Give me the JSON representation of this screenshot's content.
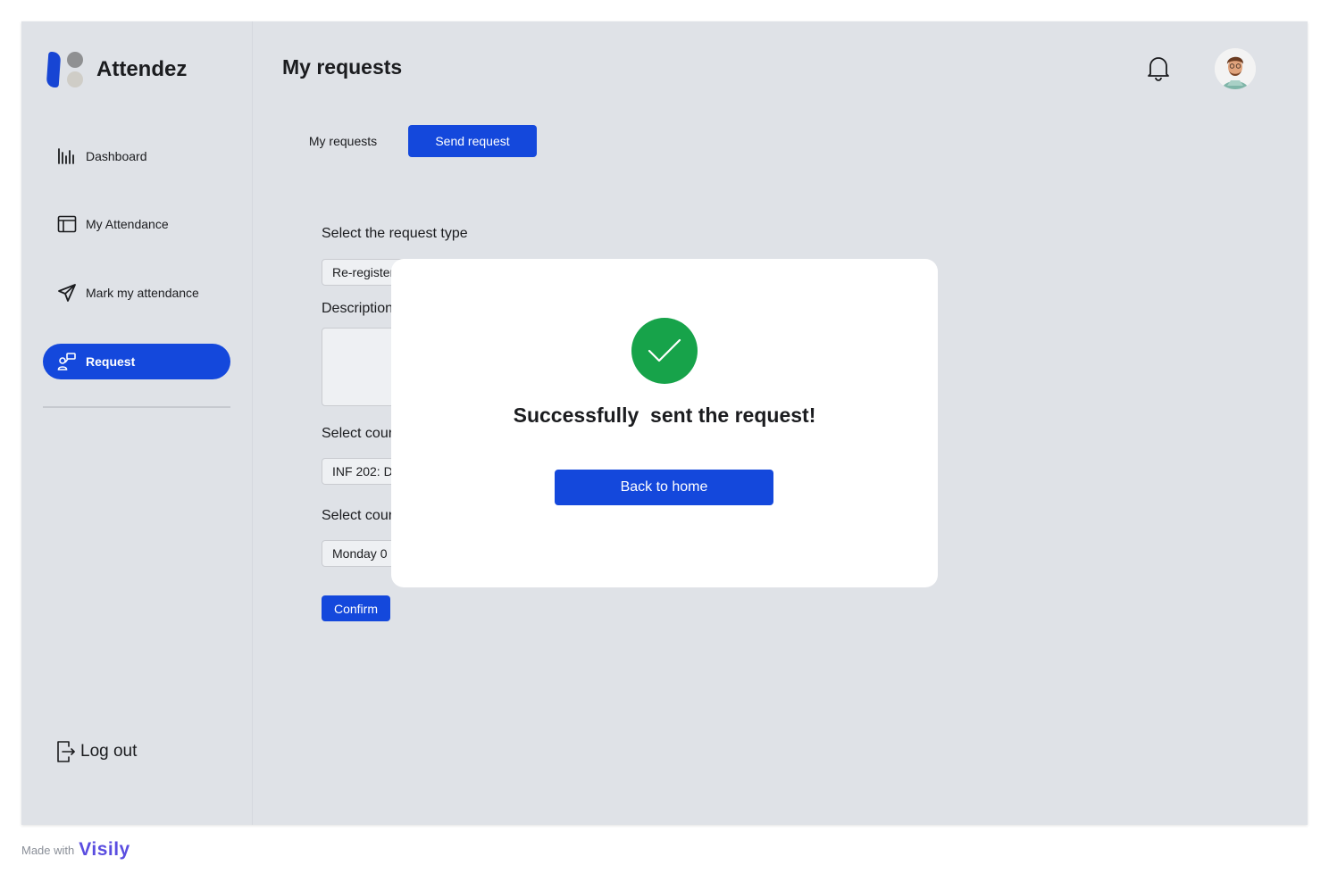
{
  "app": {
    "name": "Attendez"
  },
  "sidebar": {
    "items": [
      {
        "label": "Dashboard",
        "icon": "bar-chart-icon"
      },
      {
        "label": "My Attendance",
        "icon": "calendar-layout-icon"
      },
      {
        "label": "Mark my attendance",
        "icon": "send-icon"
      },
      {
        "label": "Request",
        "icon": "request-icon",
        "active": true
      }
    ],
    "logout_label": "Log out"
  },
  "header": {
    "title": "My requests"
  },
  "tabs": {
    "my_requests": "My requests",
    "send_request": "Send request",
    "active": "send_request"
  },
  "form": {
    "request_type_label": "Select the request type",
    "request_type_value": "Re-register",
    "description_label": "Description",
    "course_label": "Select course",
    "course_value": "INF 202: D",
    "course_time_label": "Select course",
    "course_time_value": "Monday 0",
    "confirm_label": "Confirm"
  },
  "modal": {
    "message": "Successfully  sent the request!",
    "button_label": "Back to home",
    "icon": "check-circle-icon"
  },
  "footer": {
    "made_with": "Made with",
    "brand": "Visily"
  },
  "colors": {
    "primary": "#1448dc",
    "success": "#17a34a",
    "background": "#dfe2e7"
  }
}
